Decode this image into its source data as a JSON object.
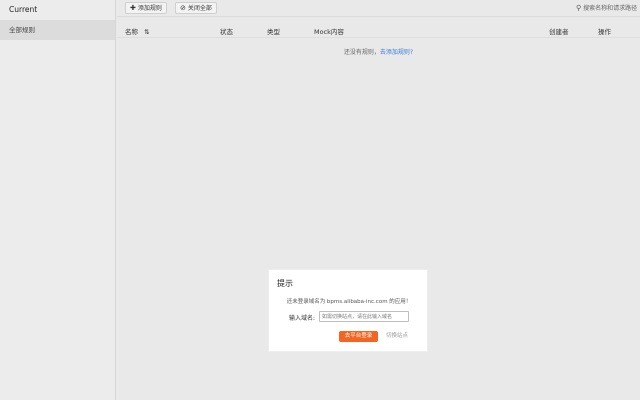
{
  "sidebar": {
    "brand": "Current",
    "items": [
      {
        "label": "全部规则"
      }
    ]
  },
  "toolbar": {
    "add_label": "添加规则",
    "close_all_label": "关闭全部",
    "search_placeholder": "搜索名称和请求路径"
  },
  "table": {
    "columns": [
      "名称",
      "状态",
      "类型",
      "Mock内容",
      "创建者",
      "操作"
    ]
  },
  "empty": {
    "text": "还没有规则，",
    "link": "去添加规则?"
  },
  "dialog": {
    "title": "提示",
    "message": "还未登录域名为 bpms.alibaba-inc.com 的应用！",
    "domain_label": "输入域名:",
    "domain_placeholder": "如需切换站点，请在此输入域名",
    "confirm_label": "去平台登录",
    "switch_label": "切换站点"
  },
  "colors": {
    "primary": "#f26522",
    "link": "#3a7bd5"
  },
  "icons": {
    "add": "plus-icon",
    "close_all": "close-circle-icon",
    "search": "search-icon",
    "sort": "sort-icon"
  }
}
